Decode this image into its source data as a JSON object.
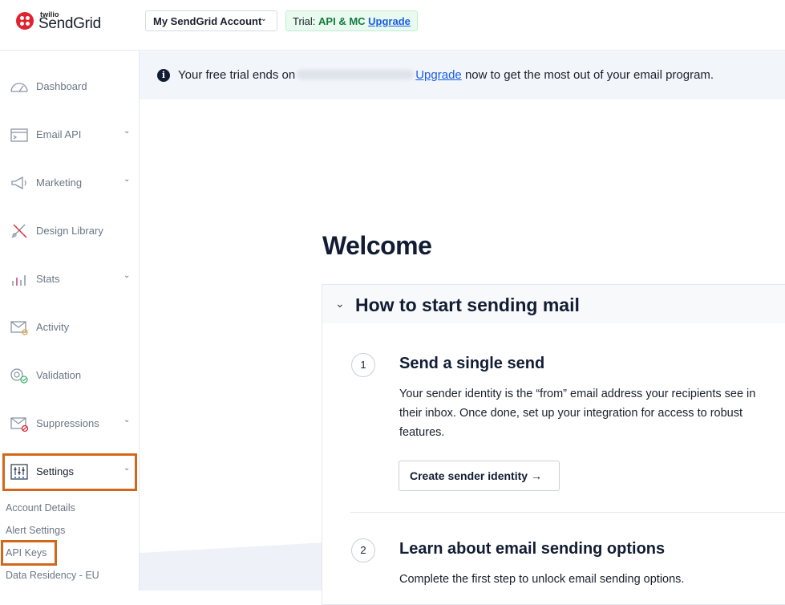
{
  "header": {
    "logo_small": "twilio",
    "logo_brand": "SendGrid",
    "account_label": "My SendGrid Account",
    "trial_label": "Trial:",
    "trial_plan": "API & MC",
    "trial_upgrade": "Upgrade"
  },
  "sidebar": {
    "items": [
      {
        "label": "Dashboard",
        "icon": "dashboard-icon",
        "has_chevron": false
      },
      {
        "label": "Email API",
        "icon": "email-api-icon",
        "has_chevron": true
      },
      {
        "label": "Marketing",
        "icon": "megaphone-icon",
        "has_chevron": true
      },
      {
        "label": "Design Library",
        "icon": "design-library-icon",
        "has_chevron": false
      },
      {
        "label": "Stats",
        "icon": "stats-icon",
        "has_chevron": true
      },
      {
        "label": "Activity",
        "icon": "activity-icon",
        "has_chevron": false
      },
      {
        "label": "Validation",
        "icon": "validation-icon",
        "has_chevron": false
      },
      {
        "label": "Suppressions",
        "icon": "suppressions-icon",
        "has_chevron": true
      },
      {
        "label": "Settings",
        "icon": "settings-icon",
        "has_chevron": true
      }
    ],
    "settings_sub": [
      "Account Details",
      "Alert Settings",
      "API Keys",
      "Data Residency - EU"
    ],
    "highlight_color": "#d4661c"
  },
  "banner": {
    "text_before": "Your free trial ends on",
    "link": "Upgrade",
    "text_after": "now to get the most out of your email program."
  },
  "main": {
    "title": "Welcome",
    "section_title": "How to start sending mail",
    "steps": [
      {
        "number": "1",
        "title": "Send a single send",
        "description": "Your sender identity is the “from” email address your recipients see in their inbox. Once done, set up your integration for access to robust features.",
        "button": "Create sender identity →"
      },
      {
        "number": "2",
        "title": "Learn about email sending options",
        "description": "Complete the first step to unlock email sending options."
      }
    ]
  },
  "colors": {
    "brand_red": "#e0232f",
    "link_blue": "#1a5ce6",
    "trial_green": "#157a3f",
    "banner_bg": "#f2f6fb"
  }
}
